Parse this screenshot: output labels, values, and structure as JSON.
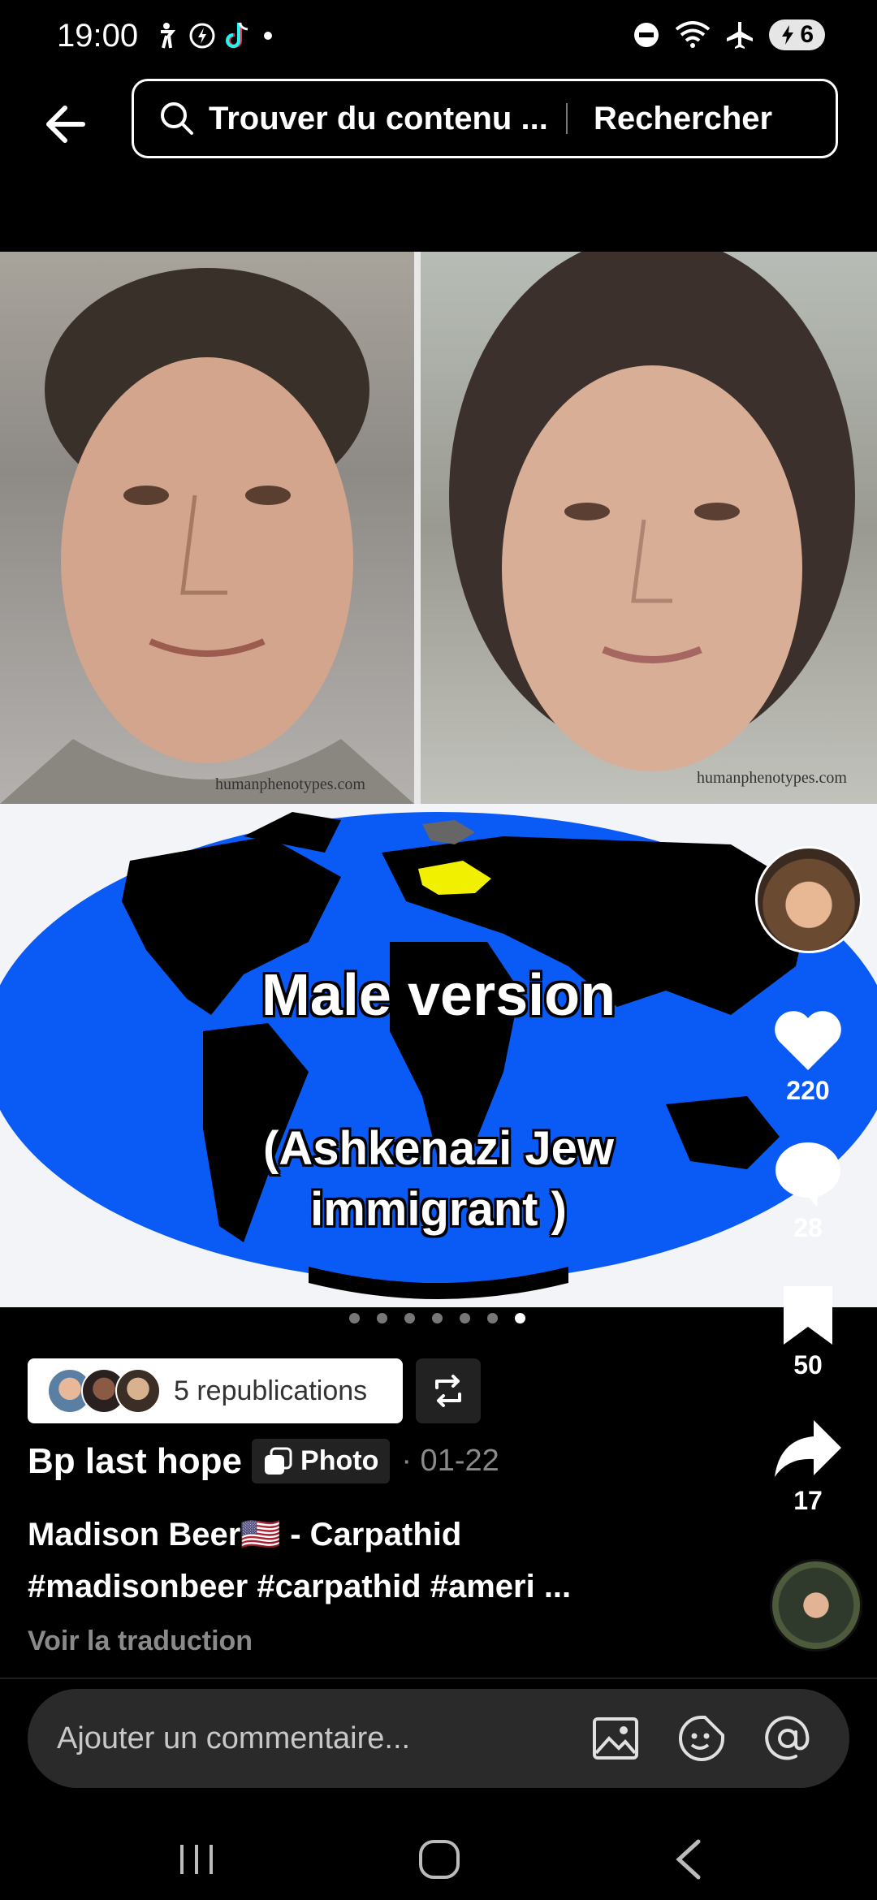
{
  "status_bar": {
    "time": "19:00",
    "battery": "6"
  },
  "header": {
    "search_placeholder": "Trouver du contenu ...",
    "search_button": "Rechercher"
  },
  "media": {
    "watermark_left": "humanphenotypes.com",
    "watermark_right": "humanphenotypes.com",
    "caption_title": "Male version",
    "caption_line2": "(Ashkenazi Jew",
    "caption_line3": "immigrant )",
    "slide_count": 7,
    "active_slide": 7
  },
  "actions": {
    "likes": "220",
    "comments": "28",
    "saves": "50",
    "shares": "17"
  },
  "post": {
    "republications": "5 republications",
    "author": "Bp last hope",
    "type_chip": "Photo",
    "date": "· 01-22",
    "description_line1": "Madison Beer🇺🇸 - Carpathid",
    "description_line2": "#madisonbeer #carpathid #ameri ...",
    "translate": "Voir la traduction"
  },
  "comment_bar": {
    "placeholder": "Ajouter un commentaire..."
  },
  "colors": {
    "map_ocean": "#0a5af5",
    "map_highlight": "#f0f000",
    "accent_white": "#ffffff"
  }
}
